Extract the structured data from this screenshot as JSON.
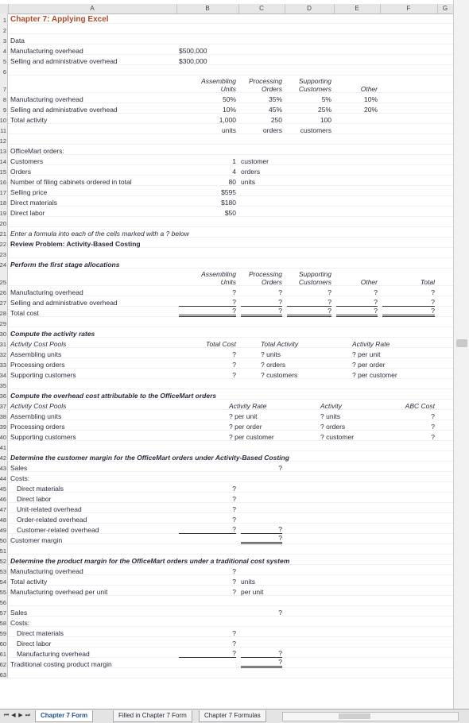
{
  "columns": [
    "A",
    "B",
    "C",
    "D",
    "E",
    "F",
    "G"
  ],
  "rows": [
    {
      "n": "1",
      "cells": [
        {
          "col": "A",
          "text": "Chapter 7: Applying Excel",
          "cls": "title"
        }
      ]
    },
    {
      "n": "2",
      "cells": []
    },
    {
      "n": "3",
      "cells": [
        {
          "col": "A",
          "text": "Data"
        }
      ]
    },
    {
      "n": "4",
      "cells": [
        {
          "col": "A",
          "text": "Manufacturing overhead"
        },
        {
          "col": "B",
          "text": "$500,000"
        }
      ]
    },
    {
      "n": "5",
      "cells": [
        {
          "col": "A",
          "text": "Selling and administrative overhead"
        },
        {
          "col": "B",
          "text": "$300,000"
        }
      ]
    },
    {
      "n": "6",
      "cells": []
    },
    {
      "n": "7",
      "tall": true,
      "cells": [
        {
          "col": "B",
          "text": "Assembling",
          "text2": "Units",
          "cls": "it r"
        },
        {
          "col": "C",
          "text": "Processing",
          "text2": "Orders",
          "cls": "it r"
        },
        {
          "col": "D",
          "text": "Supporting",
          "text2": "Customers",
          "cls": "it r"
        },
        {
          "col": "E",
          "text": "Other",
          "cls": "it r"
        }
      ]
    },
    {
      "n": "8",
      "cells": [
        {
          "col": "A",
          "text": "Manufacturing overhead"
        },
        {
          "col": "B",
          "text": "50%",
          "cls": "r"
        },
        {
          "col": "C",
          "text": "35%",
          "cls": "r"
        },
        {
          "col": "D",
          "text": "5%",
          "cls": "r"
        },
        {
          "col": "E",
          "text": "10%",
          "cls": "r"
        }
      ]
    },
    {
      "n": "9",
      "cells": [
        {
          "col": "A",
          "text": "Selling and administrative overhead"
        },
        {
          "col": "B",
          "text": "10%",
          "cls": "r"
        },
        {
          "col": "C",
          "text": "45%",
          "cls": "r"
        },
        {
          "col": "D",
          "text": "25%",
          "cls": "r"
        },
        {
          "col": "E",
          "text": "20%",
          "cls": "r"
        }
      ]
    },
    {
      "n": "10",
      "cells": [
        {
          "col": "A",
          "text": "Total activity"
        },
        {
          "col": "B",
          "text": "1,000",
          "cls": "r"
        },
        {
          "col": "C",
          "text": "250",
          "cls": "r"
        },
        {
          "col": "D",
          "text": "100",
          "cls": "r"
        }
      ]
    },
    {
      "n": "11",
      "cells": [
        {
          "col": "B",
          "text": "units",
          "cls": "r"
        },
        {
          "col": "C",
          "text": "orders",
          "cls": "r"
        },
        {
          "col": "D",
          "text": "customers",
          "cls": "r"
        }
      ]
    },
    {
      "n": "12",
      "cells": []
    },
    {
      "n": "13",
      "cells": [
        {
          "col": "A",
          "text": "OfficeMart orders:"
        }
      ]
    },
    {
      "n": "14",
      "cells": [
        {
          "col": "A",
          "text": "Customers"
        },
        {
          "col": "B",
          "text": "1",
          "cls": "r"
        },
        {
          "col": "C",
          "text": "customer"
        }
      ]
    },
    {
      "n": "15",
      "cells": [
        {
          "col": "A",
          "text": "Orders"
        },
        {
          "col": "B",
          "text": "4",
          "cls": "r"
        },
        {
          "col": "C",
          "text": "orders"
        }
      ]
    },
    {
      "n": "16",
      "cells": [
        {
          "col": "A",
          "text": "Number of filing cabinets ordered in total"
        },
        {
          "col": "B",
          "text": "80",
          "cls": "r"
        },
        {
          "col": "C",
          "text": "units"
        }
      ]
    },
    {
      "n": "17",
      "cells": [
        {
          "col": "A",
          "text": "Selling price"
        },
        {
          "col": "B",
          "text": "$595",
          "cls": "r"
        }
      ]
    },
    {
      "n": "18",
      "cells": [
        {
          "col": "A",
          "text": "Direct materials"
        },
        {
          "col": "B",
          "text": "$180",
          "cls": "r"
        }
      ]
    },
    {
      "n": "19",
      "cells": [
        {
          "col": "A",
          "text": "Direct labor"
        },
        {
          "col": "B",
          "text": "$50",
          "cls": "r"
        }
      ]
    },
    {
      "n": "20",
      "cells": []
    },
    {
      "n": "21",
      "cells": [
        {
          "col": "A",
          "text": "Enter a formula into each of the cells marked with a ? below",
          "cls": "it"
        }
      ]
    },
    {
      "n": "22",
      "cells": [
        {
          "col": "A",
          "text": "Review Problem: Activity-Based Costing",
          "cls": "b"
        }
      ]
    },
    {
      "n": "23",
      "cells": []
    },
    {
      "n": "24",
      "cells": [
        {
          "col": "A",
          "text": "Perform the first stage allocations",
          "cls": "b it"
        }
      ]
    },
    {
      "n": "25",
      "tall": true,
      "cells": [
        {
          "col": "B",
          "text": "Assembling",
          "text2": "Units",
          "cls": "it r"
        },
        {
          "col": "C",
          "text": "Processing",
          "text2": "Orders",
          "cls": "it r"
        },
        {
          "col": "D",
          "text": "Supporting",
          "text2": "Customers",
          "cls": "it r"
        },
        {
          "col": "E",
          "text": "Other",
          "cls": "it r"
        },
        {
          "col": "F",
          "text": "Total",
          "cls": "it r"
        }
      ]
    },
    {
      "n": "26",
      "cells": [
        {
          "col": "A",
          "text": "Manufacturing overhead"
        },
        {
          "col": "B",
          "text": "?",
          "cls": "r"
        },
        {
          "col": "C",
          "text": "?",
          "cls": "r"
        },
        {
          "col": "D",
          "text": "?",
          "cls": "r"
        },
        {
          "col": "E",
          "text": "?",
          "cls": "r"
        },
        {
          "col": "F",
          "text": "?",
          "cls": "r"
        }
      ]
    },
    {
      "n": "27",
      "cells": [
        {
          "col": "A",
          "text": "Selling and administrative overhead"
        },
        {
          "col": "B",
          "text": "?",
          "cls": "r ul"
        },
        {
          "col": "C",
          "text": "?",
          "cls": "r ul"
        },
        {
          "col": "D",
          "text": "?",
          "cls": "r ul"
        },
        {
          "col": "E",
          "text": "?",
          "cls": "r ul"
        },
        {
          "col": "F",
          "text": "?",
          "cls": "r ul"
        }
      ]
    },
    {
      "n": "28",
      "cells": [
        {
          "col": "A",
          "text": "Total cost"
        },
        {
          "col": "B",
          "text": "?",
          "cls": "r dul"
        },
        {
          "col": "C",
          "text": "?",
          "cls": "r dul"
        },
        {
          "col": "D",
          "text": "?",
          "cls": "r dul"
        },
        {
          "col": "E",
          "text": "?",
          "cls": "r dul"
        },
        {
          "col": "F",
          "text": "?",
          "cls": "r dul"
        }
      ]
    },
    {
      "n": "29",
      "cells": []
    },
    {
      "n": "30",
      "cells": [
        {
          "col": "A",
          "text": "Compute the activity rates",
          "cls": "b it"
        }
      ]
    },
    {
      "n": "31",
      "cells": [
        {
          "col": "A",
          "text": "Activity Cost Pools",
          "cls": "it"
        },
        {
          "col": "B",
          "text": "Total Cost",
          "cls": "it r"
        },
        {
          "col": "CD",
          "text": "Total Activity",
          "cls": "it"
        },
        {
          "col": "EF",
          "text": "Activity Rate",
          "cls": "it"
        }
      ]
    },
    {
      "n": "32",
      "cells": [
        {
          "col": "A",
          "text": "Assembling units"
        },
        {
          "col": "B",
          "text": "?",
          "cls": "r"
        },
        {
          "col": "CD",
          "text": "? units"
        },
        {
          "col": "EF",
          "text": "? per unit"
        }
      ]
    },
    {
      "n": "33",
      "cells": [
        {
          "col": "A",
          "text": "Processing orders"
        },
        {
          "col": "B",
          "text": "?",
          "cls": "r"
        },
        {
          "col": "CD",
          "text": "? orders"
        },
        {
          "col": "EF",
          "text": "? per order"
        }
      ]
    },
    {
      "n": "34",
      "cells": [
        {
          "col": "A",
          "text": "Supporting customers"
        },
        {
          "col": "B",
          "text": "?",
          "cls": "r"
        },
        {
          "col": "CD",
          "text": "? customers"
        },
        {
          "col": "EF",
          "text": "? per customer"
        }
      ]
    },
    {
      "n": "35",
      "cells": []
    },
    {
      "n": "36",
      "cells": [
        {
          "col": "A",
          "text": "Compute the overhead cost attributable to the OfficeMart orders",
          "cls": "b it"
        }
      ]
    },
    {
      "n": "37",
      "cells": [
        {
          "col": "A",
          "text": "Activity Cost Pools",
          "cls": "it"
        },
        {
          "col": "BC",
          "text": "Activity Rate",
          "cls": "it"
        },
        {
          "col": "DE",
          "text": "Activity",
          "cls": "it"
        },
        {
          "col": "F",
          "text": "ABC Cost",
          "cls": "it r"
        }
      ]
    },
    {
      "n": "38",
      "cells": [
        {
          "col": "A",
          "text": "Assembling units"
        },
        {
          "col": "BC",
          "text": "? per unit"
        },
        {
          "col": "DE",
          "text": "? units"
        },
        {
          "col": "F",
          "text": "?",
          "cls": "r"
        }
      ]
    },
    {
      "n": "39",
      "cells": [
        {
          "col": "A",
          "text": "Processing orders"
        },
        {
          "col": "BC",
          "text": "? per order"
        },
        {
          "col": "DE",
          "text": "? orders"
        },
        {
          "col": "F",
          "text": "?",
          "cls": "r"
        }
      ]
    },
    {
      "n": "40",
      "cells": [
        {
          "col": "A",
          "text": "Supporting customers"
        },
        {
          "col": "BC",
          "text": "? per customer"
        },
        {
          "col": "DE",
          "text": "? customer"
        },
        {
          "col": "F",
          "text": "?",
          "cls": "r"
        }
      ]
    },
    {
      "n": "41",
      "cells": []
    },
    {
      "n": "42",
      "cells": [
        {
          "col": "A",
          "text": "Determine the customer margin for the OfficeMart orders under Activity-Based Costing",
          "cls": "b it"
        }
      ]
    },
    {
      "n": "43",
      "cells": [
        {
          "col": "A",
          "text": "Sales"
        },
        {
          "col": "C",
          "text": "?",
          "cls": "r"
        }
      ]
    },
    {
      "n": "44",
      "cells": [
        {
          "col": "A",
          "text": "Costs:"
        }
      ]
    },
    {
      "n": "45",
      "cells": [
        {
          "col": "A",
          "text": "Direct materials",
          "indent": true
        },
        {
          "col": "B",
          "text": "?",
          "cls": "r"
        }
      ]
    },
    {
      "n": "46",
      "cells": [
        {
          "col": "A",
          "text": "Direct labor",
          "indent": true
        },
        {
          "col": "B",
          "text": "?",
          "cls": "r"
        }
      ]
    },
    {
      "n": "47",
      "cells": [
        {
          "col": "A",
          "text": "Unit-related overhead",
          "indent": true
        },
        {
          "col": "B",
          "text": "?",
          "cls": "r"
        }
      ]
    },
    {
      "n": "48",
      "cells": [
        {
          "col": "A",
          "text": "Order-related overhead",
          "indent": true
        },
        {
          "col": "B",
          "text": "?",
          "cls": "r"
        }
      ]
    },
    {
      "n": "49",
      "cells": [
        {
          "col": "A",
          "text": "Customer-related overhead",
          "indent": true
        },
        {
          "col": "B",
          "text": "?",
          "cls": "r ul"
        },
        {
          "col": "C",
          "text": "?",
          "cls": "r ul"
        }
      ]
    },
    {
      "n": "50",
      "cells": [
        {
          "col": "A",
          "text": "Customer margin"
        },
        {
          "col": "C",
          "text": "?",
          "cls": "r dul"
        }
      ]
    },
    {
      "n": "51",
      "cells": []
    },
    {
      "n": "52",
      "cells": [
        {
          "col": "A",
          "text": "Determine the product margin for the OfficeMart orders under a traditional cost system",
          "cls": "b it"
        }
      ]
    },
    {
      "n": "53",
      "cells": [
        {
          "col": "A",
          "text": "Manufacturing overhead"
        },
        {
          "col": "B",
          "text": "?",
          "cls": "r"
        }
      ]
    },
    {
      "n": "54",
      "cells": [
        {
          "col": "A",
          "text": "Total activity"
        },
        {
          "col": "B",
          "text": "?",
          "cls": "r"
        },
        {
          "col": "C",
          "text": "units"
        }
      ]
    },
    {
      "n": "55",
      "cells": [
        {
          "col": "A",
          "text": "Manufacturing overhead per unit"
        },
        {
          "col": "B",
          "text": "?",
          "cls": "r"
        },
        {
          "col": "C",
          "text": "per unit"
        }
      ]
    },
    {
      "n": "56",
      "cells": []
    },
    {
      "n": "57",
      "cells": [
        {
          "col": "A",
          "text": "Sales"
        },
        {
          "col": "C",
          "text": "?",
          "cls": "r"
        }
      ]
    },
    {
      "n": "58",
      "cells": [
        {
          "col": "A",
          "text": "Costs:"
        }
      ]
    },
    {
      "n": "59",
      "cells": [
        {
          "col": "A",
          "text": "Direct materials",
          "indent": true
        },
        {
          "col": "B",
          "text": "?",
          "cls": "r"
        }
      ]
    },
    {
      "n": "60",
      "cells": [
        {
          "col": "A",
          "text": "Direct labor",
          "indent": true
        },
        {
          "col": "B",
          "text": "?",
          "cls": "r"
        }
      ]
    },
    {
      "n": "61",
      "cells": [
        {
          "col": "A",
          "text": "Manufacturing overhead",
          "indent": true
        },
        {
          "col": "B",
          "text": "?",
          "cls": "r ul"
        },
        {
          "col": "C",
          "text": "?",
          "cls": "r ul"
        }
      ]
    },
    {
      "n": "62",
      "cells": [
        {
          "col": "A",
          "text": "Traditional costing product margin"
        },
        {
          "col": "C",
          "text": "?",
          "cls": "r dul"
        }
      ]
    },
    {
      "n": "63",
      "cells": []
    }
  ],
  "tabs": [
    "Chapter 7 Form",
    "Filled in Chapter 7 Form",
    "Chapter 7 Formulas"
  ],
  "nav_icons": [
    "first-sheet-icon",
    "prev-sheet-icon",
    "next-sheet-icon",
    "last-sheet-icon"
  ],
  "nav_glyphs": [
    "⏮",
    "◀",
    "▶",
    "⏭"
  ]
}
